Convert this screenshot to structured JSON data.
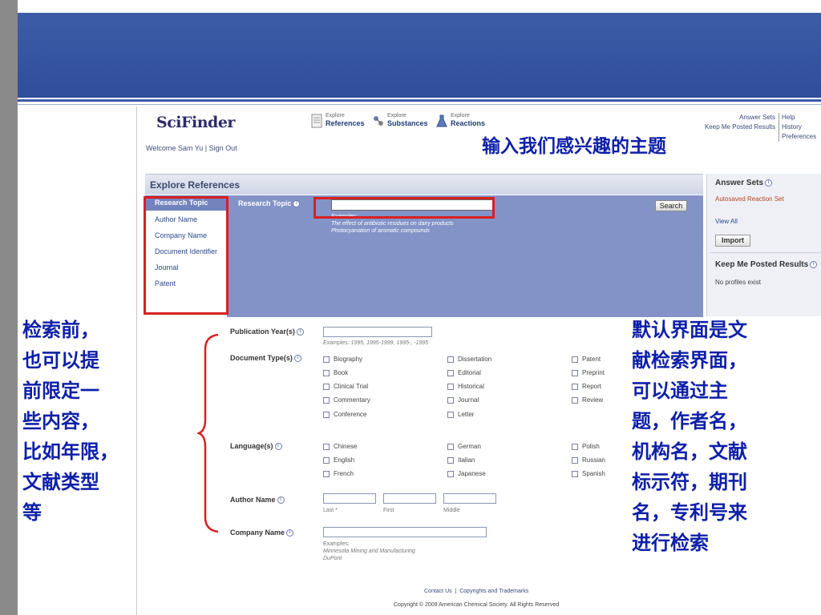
{
  "header": {
    "logo_text": "SciFinder",
    "welcome_text": "Welcome Sam Yu",
    "sign_out": "Sign Out",
    "nav": [
      {
        "small": "Explore",
        "big": "References"
      },
      {
        "small": "Explore",
        "big": "Substances"
      },
      {
        "small": "Explore",
        "big": "Reactions"
      }
    ],
    "links_left": [
      "Answer Sets",
      "Keep Me Posted Results"
    ],
    "links_right": [
      "Help",
      "History",
      "Preferences"
    ]
  },
  "annotations": {
    "header_note": "输入我们感兴趣的主题",
    "left_note": [
      "检索前，",
      "也可以提",
      "前限定一",
      "些内容，",
      "比如年限，",
      "文献类型",
      "等"
    ],
    "right_note": [
      "默认界面是文",
      "献检索界面，",
      "可以通过主",
      "题，作者名，",
      "机构名，文献",
      "标示符，期刊",
      "名，专利号来",
      "进行检索"
    ]
  },
  "explore": {
    "title": "Explore References",
    "menu": [
      "Research Topic",
      "Author Name",
      "Company Name",
      "Document Identifier",
      "Journal",
      "Patent"
    ],
    "research_topic_label": "Research Topic",
    "research_topic_value": "",
    "examples_label": "Examples:",
    "examples": [
      "The effect of antibiotic residues on dairy products",
      "Photocyanation of aromatic compounds"
    ],
    "search_button": "Search"
  },
  "right_panel": {
    "answer_sets_title": "Answer Sets",
    "autosaved": "Autosaved Reaction Set",
    "view_all": "View All",
    "import_button": "Import",
    "kmp_title": "Keep Me Posted Results",
    "no_profiles": "No profiles exist"
  },
  "filters": {
    "pub_year_label": "Publication Year(s)",
    "pub_year_hint": "Examples: 1995, 1995-1999, 1995-, -1995",
    "doc_type_label": "Document Type(s)",
    "doc_types_col1": [
      "Biography",
      "Book",
      "Clinical Trial",
      "Commentary",
      "Conference"
    ],
    "doc_types_col2": [
      "Dissertation",
      "Editorial",
      "Historical",
      "Journal",
      "Letter"
    ],
    "doc_types_col3": [
      "Patent",
      "Preprint",
      "Report",
      "Review"
    ],
    "language_label": "Language(s)",
    "languages_col1": [
      "Chinese",
      "English",
      "French"
    ],
    "languages_col2": [
      "German",
      "Italian",
      "Japanese"
    ],
    "languages_col3": [
      "Polish",
      "Russian",
      "Spanish"
    ],
    "author_label": "Author Name",
    "author_last": "Last *",
    "author_first": "First",
    "author_middle": "Middle",
    "company_label": "Company Name",
    "company_examples_label": "Examples:",
    "company_examples": [
      "Minnesota Mining and Manufacturing",
      "DuPont"
    ]
  },
  "footer": {
    "contact": "Contact Us",
    "copyrights": "Copyrights and Trademarks",
    "copyright_text": "Copyright © 2009 American Chemical Society. All Rights Reserved"
  },
  "colors": {
    "banner": "#2f4d9a",
    "panel": "#8393c7",
    "annotation": "#0e1fa8",
    "highlight": "#d92020"
  }
}
